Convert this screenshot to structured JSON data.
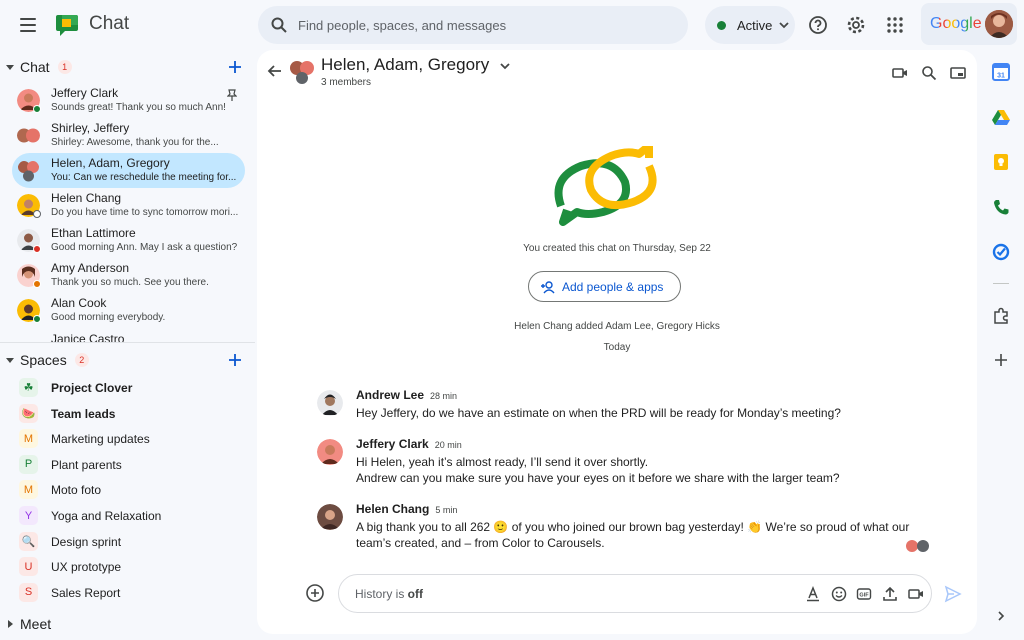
{
  "app": {
    "title": "Chat"
  },
  "search": {
    "placeholder": "Find people, spaces, and messages"
  },
  "status": {
    "label": "Active",
    "color": "#188038"
  },
  "account": {
    "brand": "Google"
  },
  "left": {
    "chat_section": {
      "title": "Chat",
      "badge": "1"
    },
    "chats": [
      {
        "name": "Jeffery Clark",
        "snippet": "Sounds great! Thank you so much Ann!",
        "presence": "#188038",
        "pinned": true
      },
      {
        "name": "Shirley, Jeffery",
        "snippet": "Shirley: Awesome, thank you for the...",
        "presence": ""
      },
      {
        "name": "Helen, Adam, Gregory",
        "snippet": "You: Can we reschedule the meeting for...",
        "presence": "",
        "active": true
      },
      {
        "name": "Helen Chang",
        "snippet": "Do you have time to sync tomorrow mori...",
        "presence": "#5f6368"
      },
      {
        "name": "Ethan Lattimore",
        "snippet": "Good morning Ann. May I ask a question?",
        "presence": "#d93025"
      },
      {
        "name": "Amy Anderson",
        "snippet": "Thank you so much. See you there.",
        "presence": "#e37400"
      },
      {
        "name": "Alan Cook",
        "snippet": "Good morning everybody.",
        "presence": "#188038"
      },
      {
        "name": "Janice Castro",
        "snippet": "",
        "presence": ""
      }
    ],
    "spaces_section": {
      "title": "Spaces",
      "badge": "2"
    },
    "spaces": [
      {
        "icon": "☘",
        "name": "Project Clover",
        "bold": true,
        "bg": "#e6f4ea",
        "fg": "#188038"
      },
      {
        "icon": "🍉",
        "name": "Team leads",
        "bold": true,
        "bg": "#fce8e6",
        "fg": "#d93025"
      },
      {
        "icon": "M",
        "name": "Marketing updates",
        "bold": false,
        "bg": "#fef7e0",
        "fg": "#e37400"
      },
      {
        "icon": "P",
        "name": "Plant parents",
        "bold": false,
        "bg": "#e6f4ea",
        "fg": "#188038"
      },
      {
        "icon": "M",
        "name": "Moto foto",
        "bold": false,
        "bg": "#fef7e0",
        "fg": "#e37400"
      },
      {
        "icon": "Y",
        "name": "Yoga and Relaxation",
        "bold": false,
        "bg": "#f3e8fd",
        "fg": "#9334e6"
      },
      {
        "icon": "🔍",
        "name": "Design sprint",
        "bold": false,
        "bg": "#fce8e6",
        "fg": "#d93025"
      },
      {
        "icon": "U",
        "name": "UX prototype",
        "bold": false,
        "bg": "#fce8e6",
        "fg": "#d93025"
      },
      {
        "icon": "S",
        "name": "Sales Report",
        "bold": false,
        "bg": "#fce8e6",
        "fg": "#d93025"
      }
    ],
    "meet_section": {
      "title": "Meet"
    }
  },
  "conversation": {
    "title": "Helen, Adam, Gregory",
    "members": "3 members",
    "created_text": "You created this chat on Thursday, Sep 22",
    "add_button": "Add people & apps",
    "system_added": "Helen Chang added Adam Lee, Gregory Hicks",
    "date_divider": "Today",
    "messages": [
      {
        "name": "Andrew Lee",
        "time": "28 min",
        "lines": [
          "Hey Jeffery, do we have an estimate on when the PRD will be ready for Monday’s meeting?"
        ]
      },
      {
        "name": "Jeffery Clark",
        "time": "20 min",
        "lines": [
          "Hi Helen, yeah it’s almost ready, I’ll send it over shortly.",
          "Andrew can you make sure you have your eyes on it before we share with the larger team?"
        ]
      },
      {
        "name": "Helen Chang",
        "time": "5 min",
        "lines": [
          "A big thank you to all 262 🙂 of you who joined our brown bag yesterday! 👏 We’re so proud of what our",
          "team’s created, and – from Color to Carousels."
        ]
      }
    ],
    "composer": {
      "history_prefix": "History is ",
      "history_state": "off"
    }
  },
  "colors": {
    "accent": "#0b57d0",
    "active_item": "#c2e7ff",
    "background": "#f6f8fc"
  }
}
